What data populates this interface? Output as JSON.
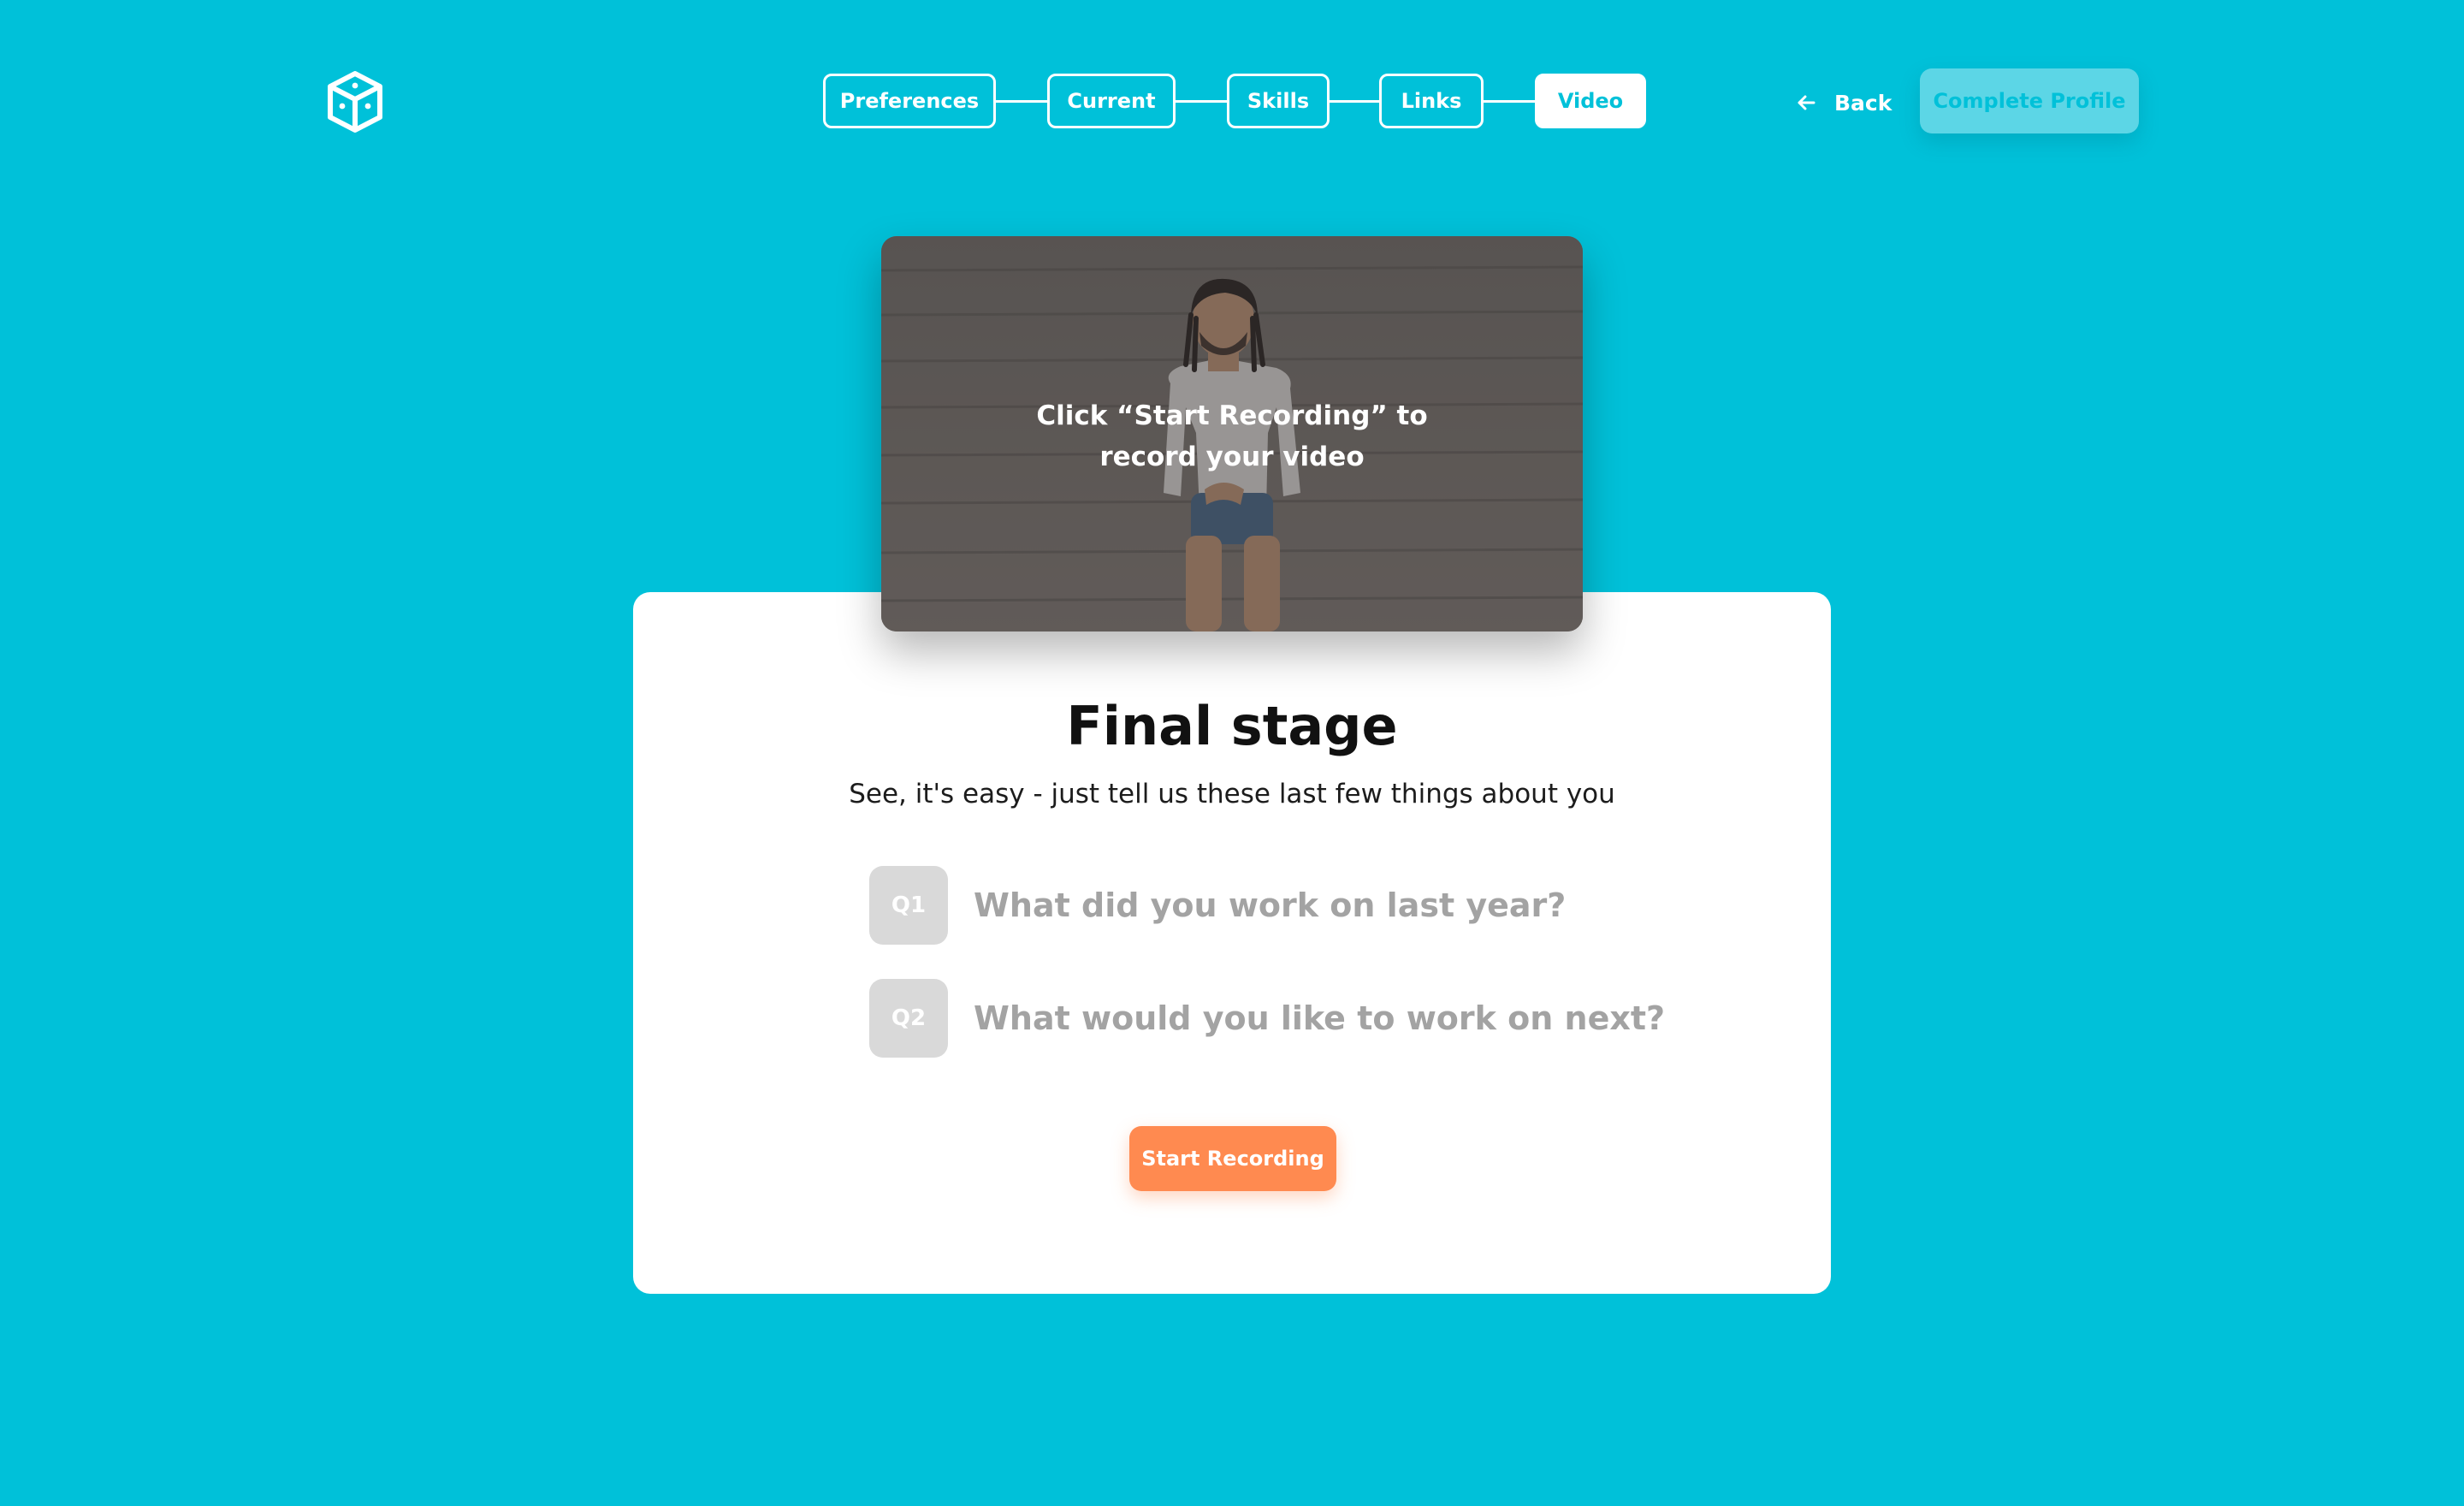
{
  "colors": {
    "background": "#00c1d9",
    "accent": "#ff8a50",
    "card": "#ffffff",
    "muted_text": "#a3a3a3",
    "badge": "#d9d9d9"
  },
  "header": {
    "logo_icon": "cube-icon",
    "steps": [
      {
        "label": "Preferences",
        "active": false
      },
      {
        "label": "Current",
        "active": false
      },
      {
        "label": "Skills",
        "active": false
      },
      {
        "label": "Links",
        "active": false
      },
      {
        "label": "Video",
        "active": true
      }
    ],
    "back_label": "Back",
    "back_icon": "arrow-left-icon",
    "complete_label": "Complete Profile"
  },
  "video": {
    "hint_line1": "Click “Start Recording” to",
    "hint_line2": "record your video"
  },
  "card": {
    "title": "Final stage",
    "subtitle": "See, it's easy - just tell us these last few things about you",
    "questions": [
      {
        "badge": "Q1",
        "text": "What did you work on last year?"
      },
      {
        "badge": "Q2",
        "text": "What would you like to work on next?"
      }
    ],
    "record_label": "Start Recording"
  }
}
